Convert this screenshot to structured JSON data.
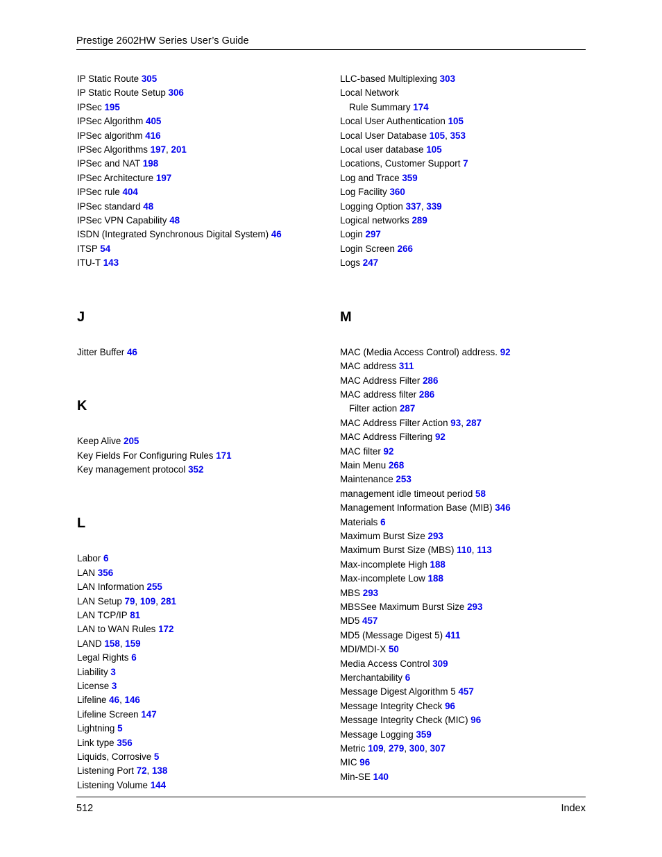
{
  "header": {
    "title": "Prestige 2602HW Series User’s Guide"
  },
  "footer": {
    "page_number": "512",
    "label": "Index"
  },
  "colors": {
    "page_number_link": "#0000ee",
    "text": "#000000",
    "background": "#ffffff"
  },
  "columns": {
    "left": {
      "blocks": [
        {
          "type": "entries",
          "entries": [
            {
              "term": "IP Static Route",
              "pages": [
                "305"
              ],
              "sub": false
            },
            {
              "term": "IP Static Route Setup",
              "pages": [
                "306"
              ],
              "sub": false
            },
            {
              "term": "IPSec",
              "pages": [
                "195"
              ],
              "sub": false
            },
            {
              "term": "IPSec Algorithm",
              "pages": [
                "405"
              ],
              "sub": false
            },
            {
              "term": "IPSec algorithm",
              "pages": [
                "416"
              ],
              "sub": false
            },
            {
              "term": "IPSec Algorithms",
              "pages": [
                "197",
                "201"
              ],
              "sub": false
            },
            {
              "term": "IPSec and NAT",
              "pages": [
                "198"
              ],
              "sub": false
            },
            {
              "term": "IPSec Architecture",
              "pages": [
                "197"
              ],
              "sub": false
            },
            {
              "term": "IPSec rule",
              "pages": [
                "404"
              ],
              "sub": false
            },
            {
              "term": "IPSec standard",
              "pages": [
                "48"
              ],
              "sub": false
            },
            {
              "term": "IPSec VPN Capability",
              "pages": [
                "48"
              ],
              "sub": false
            },
            {
              "term": "ISDN (Integrated Synchronous Digital System)",
              "pages": [
                "46"
              ],
              "sub": false
            },
            {
              "term": "ITSP",
              "pages": [
                "54"
              ],
              "sub": false
            },
            {
              "term": "ITU-T",
              "pages": [
                "143"
              ],
              "sub": false
            }
          ]
        },
        {
          "type": "section",
          "letter": "J",
          "entries": [
            {
              "term": "Jitter Buffer",
              "pages": [
                "46"
              ],
              "sub": false
            }
          ]
        },
        {
          "type": "section",
          "letter": "K",
          "entries": [
            {
              "term": "Keep Alive",
              "pages": [
                "205"
              ],
              "sub": false
            },
            {
              "term": "Key Fields For Configuring Rules",
              "pages": [
                "171"
              ],
              "sub": false
            },
            {
              "term": "Key management protocol",
              "pages": [
                "352"
              ],
              "sub": false
            }
          ]
        },
        {
          "type": "section",
          "letter": "L",
          "entries": [
            {
              "term": "Labor",
              "pages": [
                "6"
              ],
              "sub": false
            },
            {
              "term": "LAN",
              "pages": [
                "356"
              ],
              "sub": false
            },
            {
              "term": "LAN Information",
              "pages": [
                "255"
              ],
              "sub": false
            },
            {
              "term": "LAN Setup",
              "pages": [
                "79",
                "109",
                "281"
              ],
              "sub": false
            },
            {
              "term": "LAN TCP/IP",
              "pages": [
                "81"
              ],
              "sub": false
            },
            {
              "term": "LAN to WAN Rules",
              "pages": [
                "172"
              ],
              "sub": false
            },
            {
              "term": "LAND",
              "pages": [
                "158",
                "159"
              ],
              "sub": false
            },
            {
              "term": "Legal Rights",
              "pages": [
                "6"
              ],
              "sub": false
            },
            {
              "term": "Liability",
              "pages": [
                "3"
              ],
              "sub": false
            },
            {
              "term": "License",
              "pages": [
                "3"
              ],
              "sub": false
            },
            {
              "term": "Lifeline",
              "pages": [
                "46",
                "146"
              ],
              "sub": false
            },
            {
              "term": "Lifeline Screen",
              "pages": [
                "147"
              ],
              "sub": false
            },
            {
              "term": "Lightning",
              "pages": [
                "5"
              ],
              "sub": false
            },
            {
              "term": "Link type",
              "pages": [
                "356"
              ],
              "sub": false
            },
            {
              "term": "Liquids, Corrosive",
              "pages": [
                "5"
              ],
              "sub": false
            },
            {
              "term": "Listening Port",
              "pages": [
                "72",
                "138"
              ],
              "sub": false
            },
            {
              "term": "Listening Volume",
              "pages": [
                "144"
              ],
              "sub": false
            }
          ]
        }
      ]
    },
    "right": {
      "blocks": [
        {
          "type": "entries",
          "entries": [
            {
              "term": "LLC-based Multiplexing",
              "pages": [
                "303"
              ],
              "sub": false
            },
            {
              "term": "Local Network",
              "pages": [],
              "sub": false
            },
            {
              "term": "Rule Summary",
              "pages": [
                "174"
              ],
              "sub": true
            },
            {
              "term": "Local User Authentication",
              "pages": [
                "105"
              ],
              "sub": false
            },
            {
              "term": "Local User Database",
              "pages": [
                "105",
                "353"
              ],
              "sub": false
            },
            {
              "term": "Local user database",
              "pages": [
                "105"
              ],
              "sub": false
            },
            {
              "term": "Locations, Customer Support",
              "pages": [
                "7"
              ],
              "sub": false
            },
            {
              "term": "Log and Trace",
              "pages": [
                "359"
              ],
              "sub": false
            },
            {
              "term": "Log Facility",
              "pages": [
                "360"
              ],
              "sub": false
            },
            {
              "term": "Logging Option",
              "pages": [
                "337",
                "339"
              ],
              "sub": false
            },
            {
              "term": "Logical networks",
              "pages": [
                "289"
              ],
              "sub": false
            },
            {
              "term": "Login",
              "pages": [
                "297"
              ],
              "sub": false
            },
            {
              "term": "Login Screen",
              "pages": [
                "266"
              ],
              "sub": false
            },
            {
              "term": "Logs",
              "pages": [
                "247"
              ],
              "sub": false
            }
          ]
        },
        {
          "type": "section",
          "letter": "M",
          "entries": [
            {
              "term": "MAC (Media Access Control) address.",
              "pages": [
                "92"
              ],
              "sub": false
            },
            {
              "term": "MAC address",
              "pages": [
                "311"
              ],
              "sub": false
            },
            {
              "term": "MAC Address Filter",
              "pages": [
                "286"
              ],
              "sub": false
            },
            {
              "term": "MAC address filter",
              "pages": [
                "286"
              ],
              "sub": false
            },
            {
              "term": "Filter action",
              "pages": [
                "287"
              ],
              "sub": true
            },
            {
              "term": "MAC Address Filter Action",
              "pages": [
                "93",
                "287"
              ],
              "sub": false
            },
            {
              "term": "MAC Address Filtering",
              "pages": [
                "92"
              ],
              "sub": false
            },
            {
              "term": "MAC filter",
              "pages": [
                "92"
              ],
              "sub": false
            },
            {
              "term": "Main Menu",
              "pages": [
                "268"
              ],
              "sub": false
            },
            {
              "term": "Maintenance",
              "pages": [
                "253"
              ],
              "sub": false
            },
            {
              "term": "management idle timeout period",
              "pages": [
                "58"
              ],
              "sub": false
            },
            {
              "term": "Management Information Base (MIB)",
              "pages": [
                "346"
              ],
              "sub": false
            },
            {
              "term": "Materials",
              "pages": [
                "6"
              ],
              "sub": false
            },
            {
              "term": "Maximum Burst Size",
              "pages": [
                "293"
              ],
              "sub": false
            },
            {
              "term": "Maximum Burst Size (MBS)",
              "pages": [
                "110",
                "113"
              ],
              "sub": false
            },
            {
              "term": "Max-incomplete High",
              "pages": [
                "188"
              ],
              "sub": false
            },
            {
              "term": "Max-incomplete Low",
              "pages": [
                "188"
              ],
              "sub": false
            },
            {
              "term": "MBS",
              "pages": [
                "293"
              ],
              "sub": false
            },
            {
              "term": "MBSSee Maximum Burst Size",
              "pages": [
                "293"
              ],
              "sub": false
            },
            {
              "term": "MD5",
              "pages": [
                "457"
              ],
              "sub": false
            },
            {
              "term": "MD5 (Message Digest 5)",
              "pages": [
                "411"
              ],
              "sub": false
            },
            {
              "term": "MDI/MDI-X",
              "pages": [
                "50"
              ],
              "sub": false
            },
            {
              "term": "Media Access Control",
              "pages": [
                "309"
              ],
              "sub": false
            },
            {
              "term": "Merchantability",
              "pages": [
                "6"
              ],
              "sub": false
            },
            {
              "term": "Message Digest Algorithm 5",
              "pages": [
                "457"
              ],
              "sub": false
            },
            {
              "term": "Message Integrity Check",
              "pages": [
                "96"
              ],
              "sub": false
            },
            {
              "term": "Message Integrity Check (MIC)",
              "pages": [
                "96"
              ],
              "sub": false
            },
            {
              "term": "Message Logging",
              "pages": [
                "359"
              ],
              "sub": false
            },
            {
              "term": "Metric",
              "pages": [
                "109",
                "279",
                "300",
                "307"
              ],
              "sub": false
            },
            {
              "term": "MIC",
              "pages": [
                "96"
              ],
              "sub": false
            },
            {
              "term": "Min-SE",
              "pages": [
                "140"
              ],
              "sub": false
            }
          ]
        }
      ]
    }
  }
}
